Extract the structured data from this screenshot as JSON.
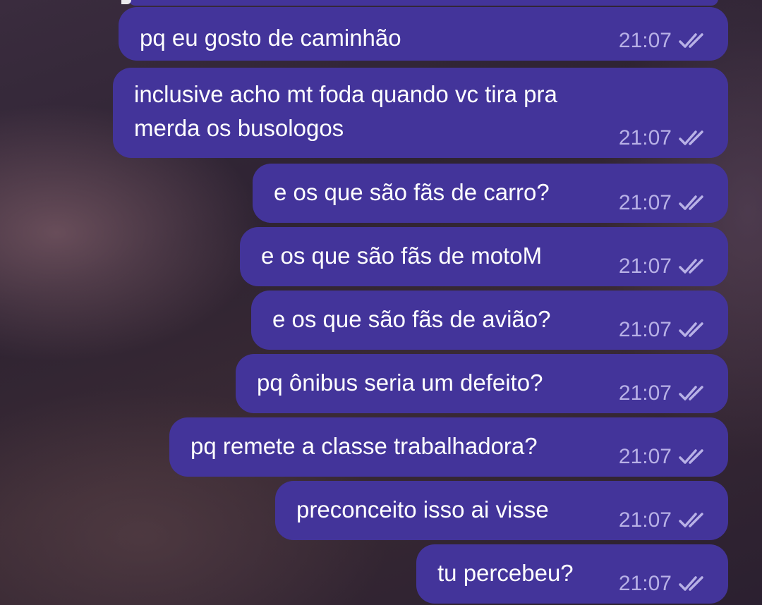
{
  "messages": [
    {
      "text": "pq eu gosto de caminhão",
      "time": "21:07",
      "status_icon": "double-check-icon"
    },
    {
      "text": "inclusive acho mt foda quando vc tira pra\nmerda os busologos",
      "time": "21:07",
      "status_icon": "double-check-icon"
    },
    {
      "text": "e os que são fãs de carro?",
      "time": "21:07",
      "status_icon": "double-check-icon"
    },
    {
      "text": "e os que são fãs de motoM",
      "time": "21:07",
      "status_icon": "double-check-icon"
    },
    {
      "text": "e os que são fãs de avião?",
      "time": "21:07",
      "status_icon": "double-check-icon"
    },
    {
      "text": "pq ônibus seria um defeito?",
      "time": "21:07",
      "status_icon": "double-check-icon"
    },
    {
      "text": "pq remete a classe trabalhadora?",
      "time": "21:07",
      "status_icon": "double-check-icon"
    },
    {
      "text": "preconceito isso ai visse",
      "time": "21:07",
      "status_icon": "double-check-icon"
    },
    {
      "text": "tu percebeu?",
      "time": "21:07",
      "status_icon": "double-check-icon"
    }
  ],
  "colors": {
    "bubble_background": "#43349a",
    "message_text": "#ffffff",
    "time_text": "#b8b1e6",
    "check_color": "#b8b1e6"
  }
}
